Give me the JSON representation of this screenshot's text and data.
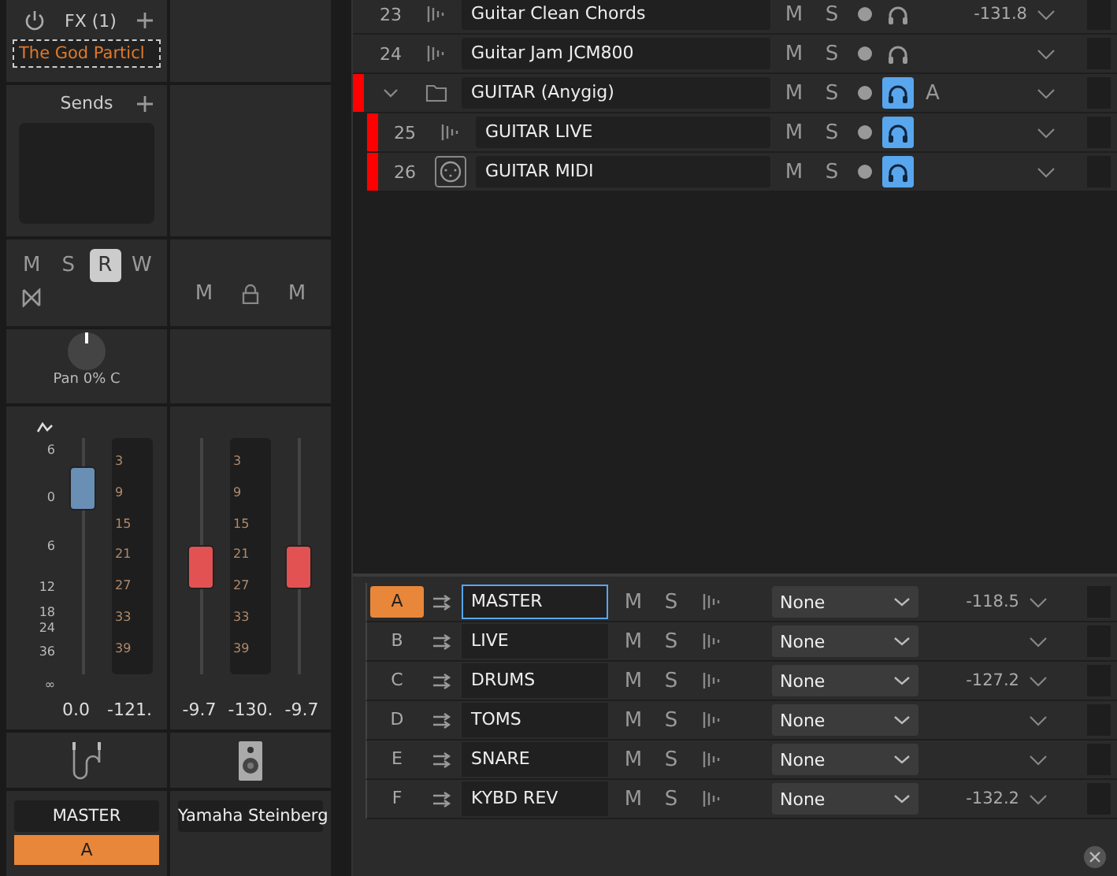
{
  "mixer": {
    "strips": [
      {
        "kind": "bus",
        "fx": {
          "title": "FX (1)",
          "plugin": "The God Particl"
        },
        "sends": {
          "title": "Sends"
        },
        "buttons": [
          {
            "label": "M",
            "selected": false
          },
          {
            "label": "S",
            "selected": false
          },
          {
            "label": "R",
            "selected": true
          },
          {
            "label": "W",
            "selected": false
          }
        ],
        "pan": {
          "label": "Pan 0% C"
        },
        "scale": [
          "6",
          "0",
          "6",
          "12",
          "18",
          "24",
          "36",
          "∞"
        ],
        "meter": [
          "3",
          "9",
          "15",
          "21",
          "27",
          "33",
          "39"
        ],
        "faders": [
          {
            "level": 0.8,
            "reading": "0.0",
            "color": "#6a8fb5"
          }
        ],
        "meter_reading": "-121.",
        "name": "MASTER",
        "bus_letter": "A"
      },
      {
        "kind": "output",
        "buttons": [
          {
            "label": "M",
            "selected": false
          },
          {
            "label": "M",
            "selected": false
          }
        ],
        "meter": [
          "3",
          "9",
          "15",
          "21",
          "27",
          "33",
          "39"
        ],
        "faders": [
          {
            "level": 0.47,
            "reading": "-9.7",
            "color": "#e25252"
          },
          {
            "level": 0.47,
            "reading": "-9.7",
            "color": "#e25252"
          }
        ],
        "meter_reading": "-130.",
        "name": "Yamaha Steinberg"
      }
    ]
  },
  "tracks": [
    {
      "kind": "audio",
      "number": "23",
      "name": "Guitar Clean Chords",
      "mute": "M",
      "solo": "S",
      "monitor": false,
      "reading": "-131.8"
    },
    {
      "kind": "audio",
      "number": "24",
      "name": "Guitar Jam JCM800",
      "mute": "M",
      "solo": "S",
      "monitor": false
    },
    {
      "kind": "folder",
      "name": "GUITAR (Anygig)",
      "color": "#ff0000",
      "expanded": true,
      "mute": "M",
      "solo": "S",
      "monitor": true,
      "auto": "A",
      "children": [
        {
          "kind": "audio",
          "number": "25",
          "name": "GUITAR LIVE",
          "color": "#ff0000",
          "mute": "M",
          "solo": "S",
          "monitor": true
        },
        {
          "kind": "midi",
          "number": "26",
          "name": "GUITAR MIDI",
          "color": "#ff0000",
          "mute": "M",
          "solo": "S",
          "monitor": true
        }
      ]
    }
  ],
  "buses": [
    {
      "letter": "A",
      "selected": true,
      "name": "MASTER",
      "editing": true,
      "mute": "M",
      "solo": "S",
      "output": "None",
      "reading": "-118.5"
    },
    {
      "letter": "B",
      "selected": false,
      "name": "LIVE",
      "editing": false,
      "mute": "M",
      "solo": "S",
      "output": "None"
    },
    {
      "letter": "C",
      "selected": false,
      "name": "DRUMS",
      "editing": false,
      "mute": "M",
      "solo": "S",
      "output": "None",
      "reading": "-127.2"
    },
    {
      "letter": "D",
      "selected": false,
      "name": "TOMS",
      "editing": false,
      "mute": "M",
      "solo": "S",
      "output": "None"
    },
    {
      "letter": "E",
      "selected": false,
      "name": "SNARE",
      "editing": false,
      "mute": "M",
      "solo": "S",
      "output": "None"
    },
    {
      "letter": "F",
      "selected": false,
      "name": "KYBD REV",
      "editing": false,
      "mute": "M",
      "solo": "S",
      "output": "None",
      "reading": "-132.2"
    }
  ]
}
